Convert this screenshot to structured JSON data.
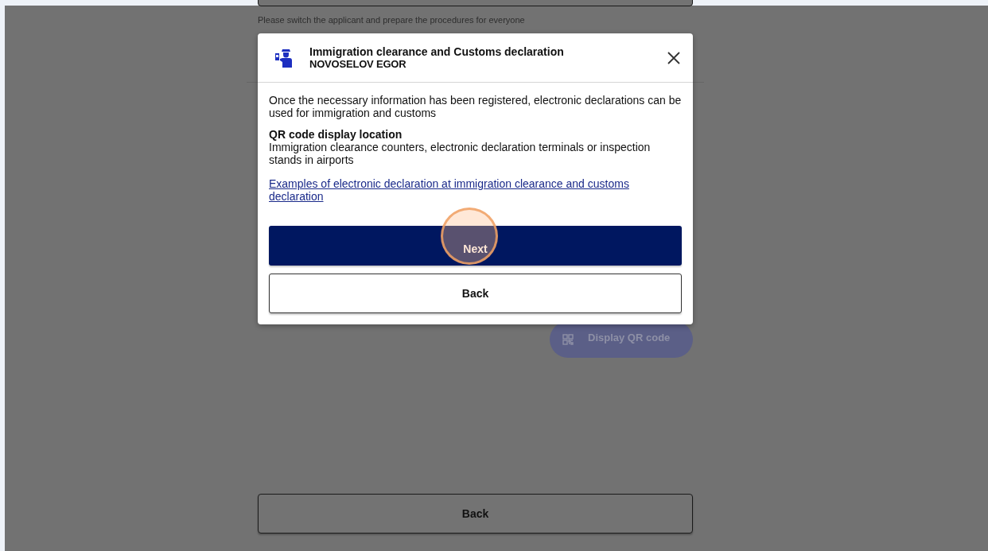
{
  "page": {
    "field_hint": "Please switch the applicant and prepare the procedures for everyone",
    "qr_button": "Display QR code",
    "back_button": "Back"
  },
  "dialog": {
    "title": "Immigration clearance and Customs declaration",
    "subtitle": "NOVOSELOV EGOR",
    "intro": "Once the necessary information has been registered, electronic declarations can be used for immigration and customs",
    "section_heading": "QR code display location",
    "section_text": "Immigration clearance counters, electronic declaration terminals or inspection stands in airports",
    "link": "Examples of electronic declaration at immigration clearance and customs declaration",
    "buttons": [
      {
        "label": "Next",
        "kind": "primary"
      },
      {
        "label": "Back",
        "kind": "secondary"
      }
    ]
  }
}
